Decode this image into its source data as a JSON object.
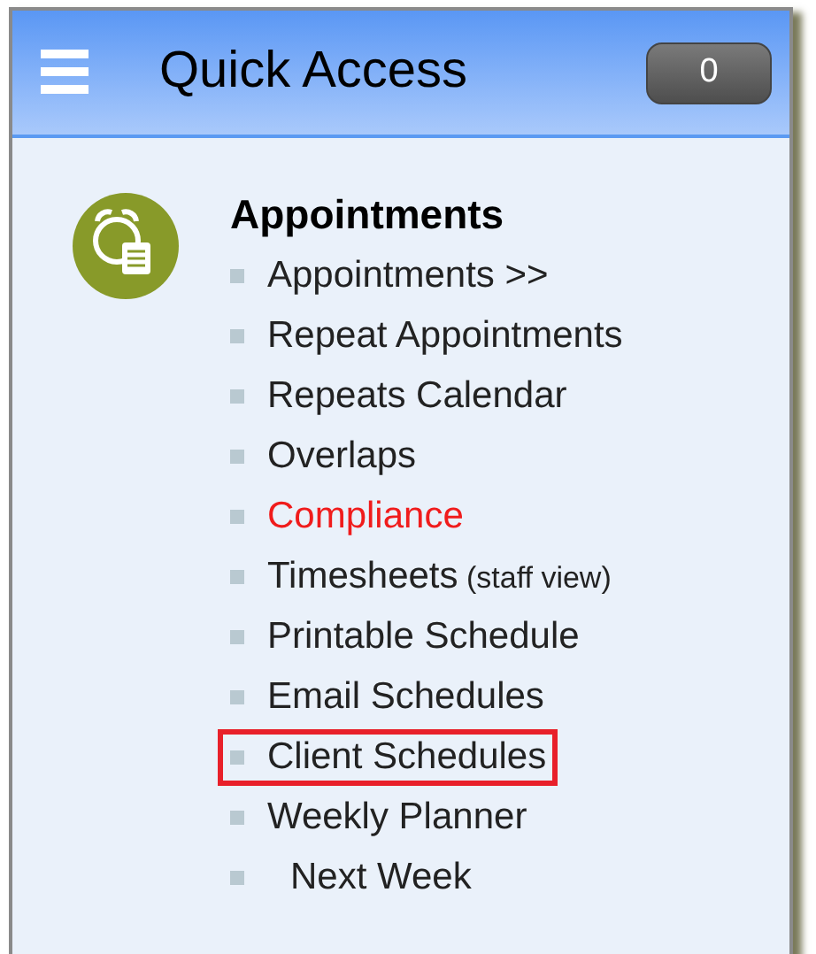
{
  "header": {
    "title": "Quick Access",
    "badge": "0"
  },
  "section": {
    "title": "Appointments",
    "items": [
      {
        "label": "Appointments >>",
        "alert": false,
        "highlighted": false
      },
      {
        "label": "Repeat Appointments",
        "alert": false,
        "highlighted": false
      },
      {
        "label": "Repeats Calendar",
        "alert": false,
        "highlighted": false
      },
      {
        "label": "Overlaps",
        "alert": false,
        "highlighted": false
      },
      {
        "label": "Compliance",
        "alert": true,
        "highlighted": false
      },
      {
        "label": "Timesheets",
        "note": "(staff view)",
        "alert": false,
        "highlighted": false
      },
      {
        "label": "Printable Schedule",
        "alert": false,
        "highlighted": false
      },
      {
        "label": "Email Schedules",
        "alert": false,
        "highlighted": false
      },
      {
        "label": "Client Schedules",
        "alert": false,
        "highlighted": true
      },
      {
        "label": "Weekly Planner",
        "alert": false,
        "highlighted": false,
        "children": [
          {
            "label": "Next Week",
            "alert": false,
            "highlighted": false
          }
        ]
      }
    ]
  }
}
